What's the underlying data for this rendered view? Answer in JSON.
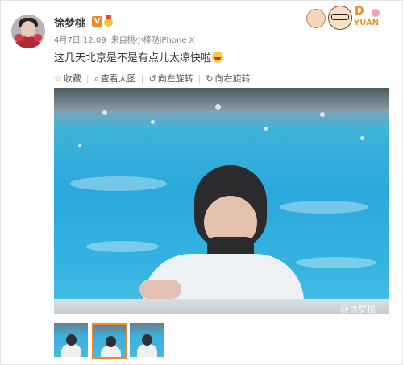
{
  "post": {
    "username": "徐梦桃",
    "verified_badge": "V",
    "date": "4月7日 12:09",
    "source_prefix": "来自",
    "source": "桃小棒哒iPhone X",
    "text": "这几天北京是不是有点儿太凉快啦",
    "sticker_text": "D",
    "sticker_yuan": "YUAN"
  },
  "actions": [
    {
      "label": "收藏",
      "icon": "star-icon",
      "glyph": "☆"
    },
    {
      "label": "查看大图",
      "icon": "zoom-icon",
      "glyph": "⌕"
    },
    {
      "label": "向左旋转",
      "icon": "rotate-left-icon",
      "glyph": "↺"
    },
    {
      "label": "向右旋转",
      "icon": "rotate-right-icon",
      "glyph": "↻"
    }
  ],
  "photo": {
    "watermark": "@徐梦桃"
  },
  "thumbnails": {
    "count": 3,
    "selected_index": 1
  },
  "colors": {
    "accent": "#f08a24",
    "text": "#333333",
    "meta": "#808080",
    "pool": "#2aa8dc"
  }
}
